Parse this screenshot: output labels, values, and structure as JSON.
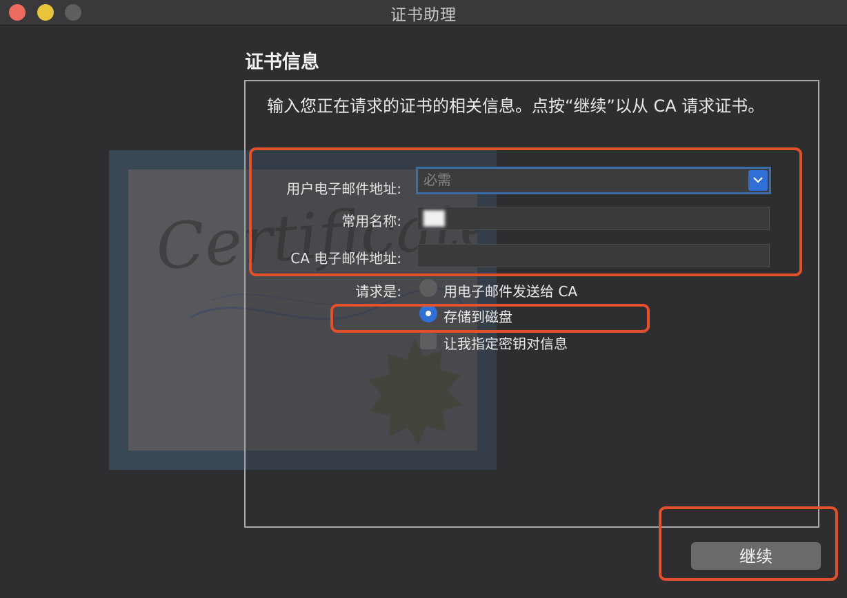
{
  "window": {
    "title": "证书助理"
  },
  "section": {
    "title": "证书信息"
  },
  "intro": {
    "text": "输入您正在请求的证书的相关信息。点按“继续”以从 CA 请求证书。"
  },
  "form": {
    "email_label": "用户电子邮件地址:",
    "email_placeholder": "必需",
    "name_label": "常用名称:",
    "name_value": "██",
    "ca_email_label": "CA 电子邮件地址:",
    "ca_email_value": "",
    "request_label": "请求是:",
    "option_email_ca": "用电子邮件发送给 CA",
    "option_save_disk": "存储到磁盘",
    "option_key_info": "让我指定密钥对信息",
    "selected_option": "存储到磁盘",
    "key_info_checked": false
  },
  "buttons": {
    "continue": "继续"
  },
  "illustration": {
    "text": "Certificate"
  },
  "colors": {
    "accent": "#2f6fd6",
    "annotation": "#e2502c"
  }
}
